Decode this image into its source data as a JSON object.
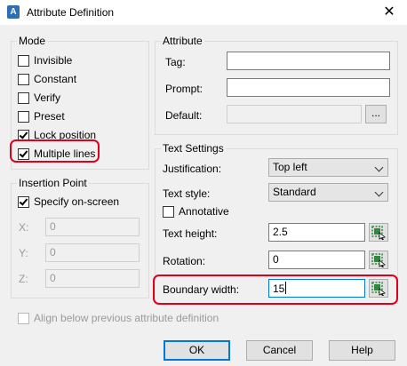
{
  "window": {
    "title": "Attribute Definition",
    "app_icon_glyph": "A",
    "close_glyph": "✕"
  },
  "mode": {
    "label": "Mode",
    "items": [
      {
        "label": "Invisible",
        "checked": false,
        "disabled": false
      },
      {
        "label": "Constant",
        "checked": false,
        "disabled": false
      },
      {
        "label": "Verify",
        "checked": false,
        "disabled": false
      },
      {
        "label": "Preset",
        "checked": false,
        "disabled": false
      },
      {
        "label": "Lock position",
        "checked": true,
        "disabled": false
      },
      {
        "label": "Multiple lines",
        "checked": true,
        "disabled": false
      }
    ]
  },
  "attribute": {
    "label": "Attribute",
    "tag_label": "Tag:",
    "tag_value": "",
    "prompt_label": "Prompt:",
    "prompt_value": "",
    "default_label": "Default:",
    "default_value": "",
    "browse_label": "..."
  },
  "insertion": {
    "label": "Insertion Point",
    "specify_label": "Specify on-screen",
    "specify_checked": true,
    "x_label": "X:",
    "x_value": "0",
    "y_label": "Y:",
    "y_value": "0",
    "z_label": "Z:",
    "z_value": "0"
  },
  "text_settings": {
    "label": "Text Settings",
    "justification_label": "Justification:",
    "justification_value": "Top left",
    "style_label": "Text style:",
    "style_value": "Standard",
    "annotative_label": "Annotative",
    "annotative_checked": false,
    "height_label": "Text height:",
    "height_value": "2.5",
    "rotation_label": "Rotation:",
    "rotation_value": "0",
    "boundary_label": "Boundary width:",
    "boundary_value": "15"
  },
  "align_label": "Align below previous attribute definition",
  "buttons": {
    "ok": "OK",
    "cancel": "Cancel",
    "help": "Help"
  },
  "colors": {
    "highlight": "#e0001b",
    "focus": "#0078d7",
    "icon_blue": "#2f6db5",
    "pick_green": "#2d8a3e"
  }
}
